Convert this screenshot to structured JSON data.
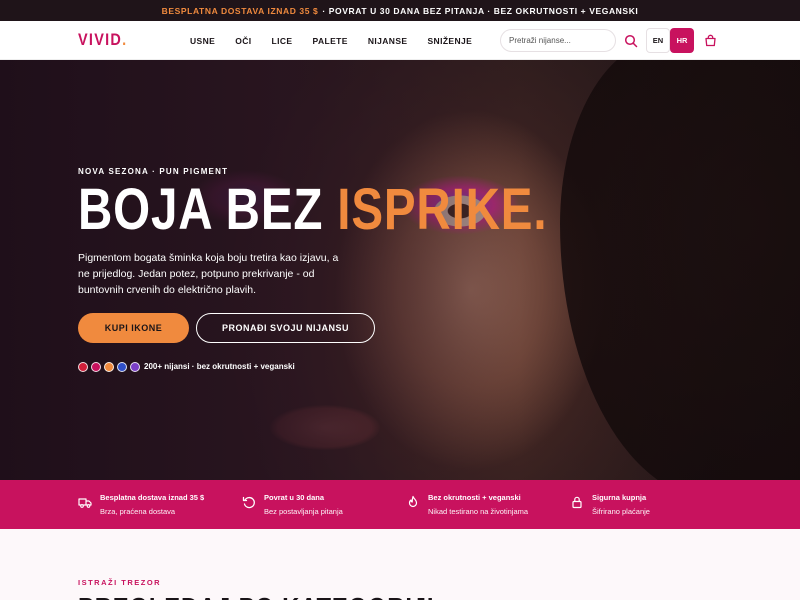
{
  "topbar": {
    "highlight": "BESPLATNA DOSTAVA IZNAD 35 $",
    "rest": "· POVRAT U 30 DANA BEZ PITANJA · BEZ OKRUTNOSTI + VEGANSKI"
  },
  "header": {
    "logo": "VIVID",
    "logo_dot": ".",
    "nav": [
      "USNE",
      "OČI",
      "LICE",
      "PALETE",
      "NIJANSE",
      "SNIŽENJE"
    ],
    "search": {
      "placeholder": "Pretraži nijanse..."
    },
    "lang": {
      "en": "EN",
      "hr": "HR",
      "active": "HR"
    },
    "icons": {
      "search": "search-icon",
      "cart": "shopping-bag-icon"
    }
  },
  "hero": {
    "eyebrow": "NOVA SEZONA · PUN PIGMENT",
    "headline_main": "BOJA BEZ ",
    "headline_accent": "ISPRIKE.",
    "description": "Pigmentom bogata šminka koja boju tretira kao izjavu, a ne prijedlog. Jedan potez, potpuno prekrivanje - od buntovnih crvenih do električno plavih.",
    "cta_primary": "KUPI IKONE",
    "cta_secondary": "PRONAĐI SVOJU NIJANSU",
    "swatches": [
      "#d0203a",
      "#c8125e",
      "#f08a3e",
      "#2f4fc8",
      "#7b3fc8"
    ],
    "swatch_note": "200+ nijansi · bez okrutnosti + veganski"
  },
  "features": [
    {
      "icon": "truck-icon",
      "title": "Besplatna dostava iznad 35 $",
      "subtitle": "Brza, praćena dostava"
    },
    {
      "icon": "return-icon",
      "title": "Povrat u 30 dana",
      "subtitle": "Bez postavljanja pitanja"
    },
    {
      "icon": "flame-icon",
      "title": "Bez okrutnosti + veganski",
      "subtitle": "Nikad testirano na životinjama"
    },
    {
      "icon": "lock-icon",
      "title": "Sigurna kupnja",
      "subtitle": "Šifrirano plaćanje"
    }
  ],
  "section": {
    "label": "ISTRAŽI TREZOR",
    "title": "PREGLEDAJ PO KATEGORIJI"
  },
  "colors": {
    "brand": "#c8125e",
    "accent": "#f08a3e",
    "topbar_bg": "#1f1419"
  }
}
